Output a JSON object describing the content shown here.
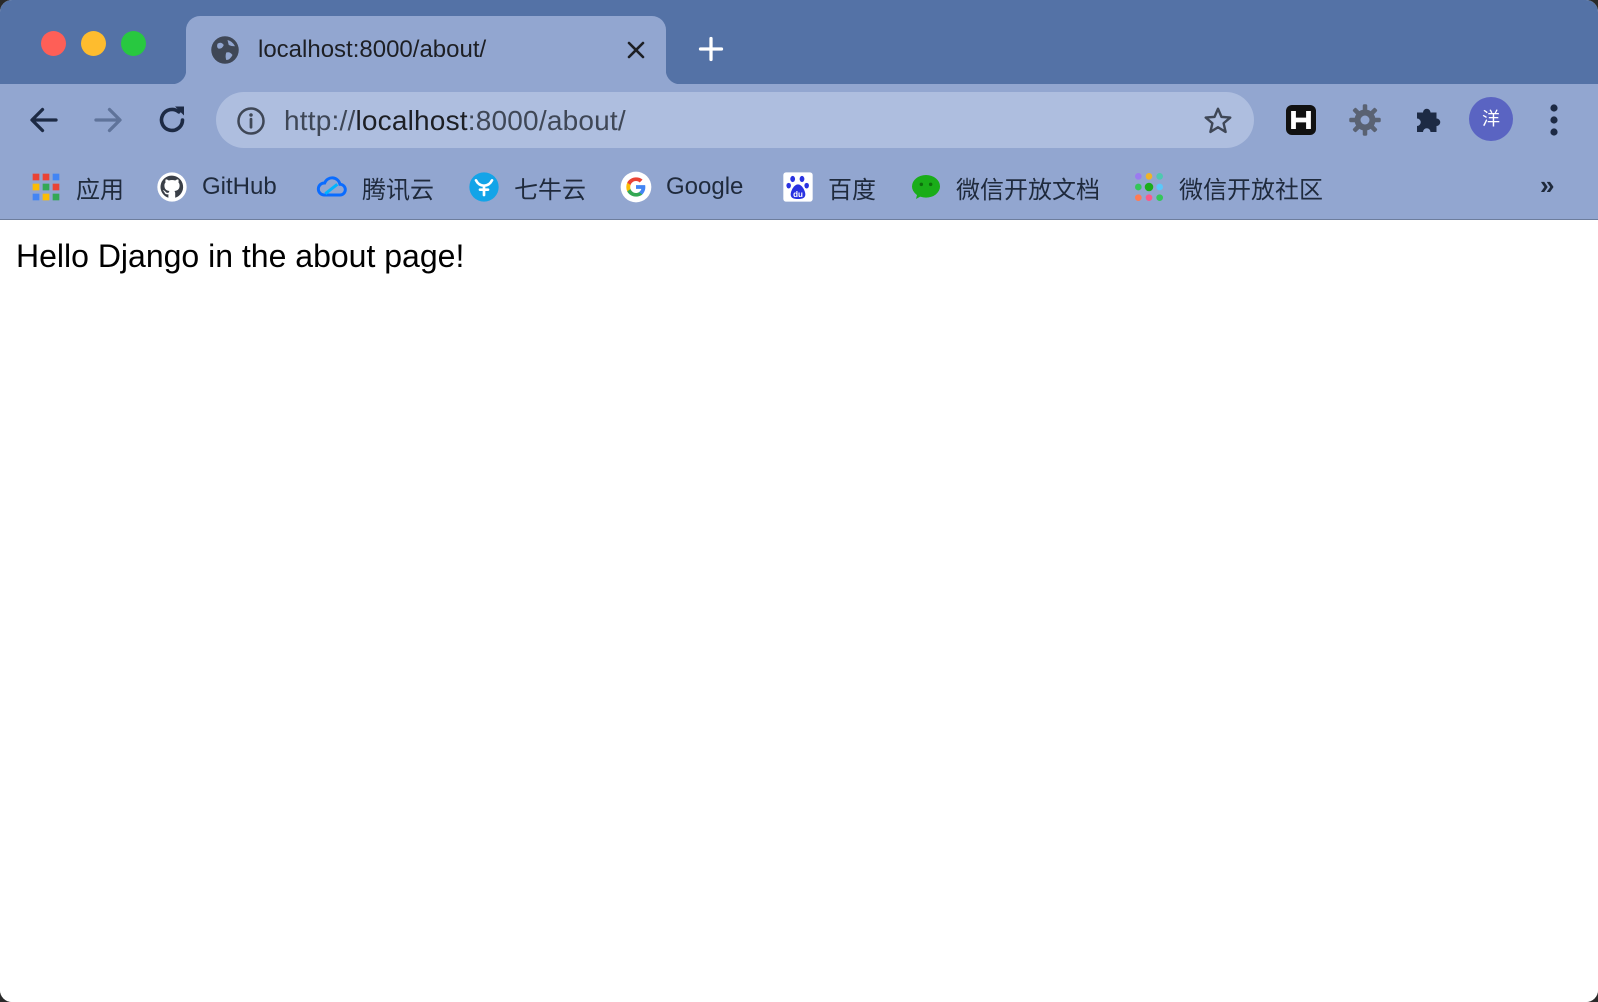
{
  "window": {
    "traffic_lights": [
      "close",
      "minimize",
      "zoom"
    ]
  },
  "tab": {
    "title": "localhost:8000/about/",
    "favicon": "globe-icon"
  },
  "toolbar": {
    "url": "http://localhost:8000/about/",
    "url_prefix": "http://",
    "url_host": "localhost",
    "url_rest": ":8000/about/",
    "avatar_initial": "洋",
    "extensions": [
      "h-extension-icon",
      "gear-extension-icon",
      "puzzle-icon"
    ]
  },
  "bookmarks": [
    {
      "label": "应用",
      "icon": "apps-grid-icon"
    },
    {
      "label": "GitHub",
      "icon": "github-icon"
    },
    {
      "label": "腾讯云",
      "icon": "tencent-cloud-icon"
    },
    {
      "label": "七牛云",
      "icon": "qiniu-icon"
    },
    {
      "label": "Google",
      "icon": "google-icon"
    },
    {
      "label": "百度",
      "icon": "baidu-icon"
    },
    {
      "label": "微信开放文档",
      "icon": "wechat-icon"
    },
    {
      "label": "微信开放社区",
      "icon": "wechat-community-icon"
    }
  ],
  "bookmarks_more": "»",
  "page": {
    "text": "Hello Django in the about page!"
  },
  "colors": {
    "tabstrip": "#5472a6",
    "toolbar": "#92a6d0",
    "omnibox": "#aebedf",
    "avatar": "#5a64c2"
  }
}
